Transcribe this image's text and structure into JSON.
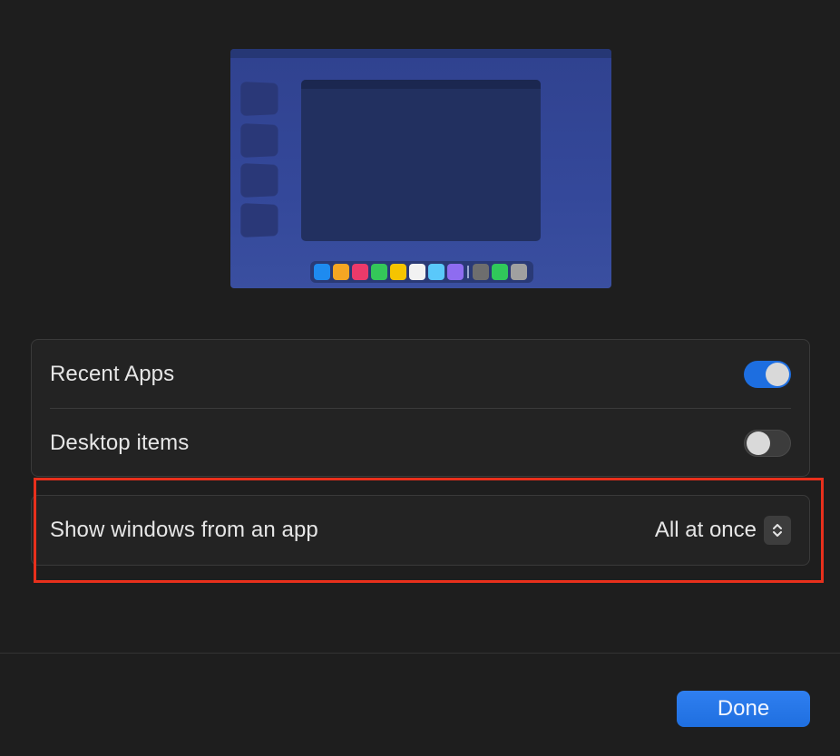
{
  "settings": {
    "recent_apps": {
      "label": "Recent Apps",
      "enabled": true
    },
    "desktop_items": {
      "label": "Desktop items",
      "enabled": false
    },
    "show_windows": {
      "label": "Show windows from an app",
      "value": "All at once"
    }
  },
  "footer": {
    "done_label": "Done"
  },
  "colors": {
    "accent": "#1d6ee0",
    "highlight": "#e8301c",
    "background": "#1e1e1e"
  },
  "preview": {
    "dock_icon_colors": [
      "#1e8bf0",
      "#f5a623",
      "#ec3a6a",
      "#34c759",
      "#f5c400",
      "#f2f2f2",
      "#5ac8fa",
      "#8e6cf0",
      "#6e6e6e",
      "#30c85a",
      "#a0a0a0"
    ]
  }
}
